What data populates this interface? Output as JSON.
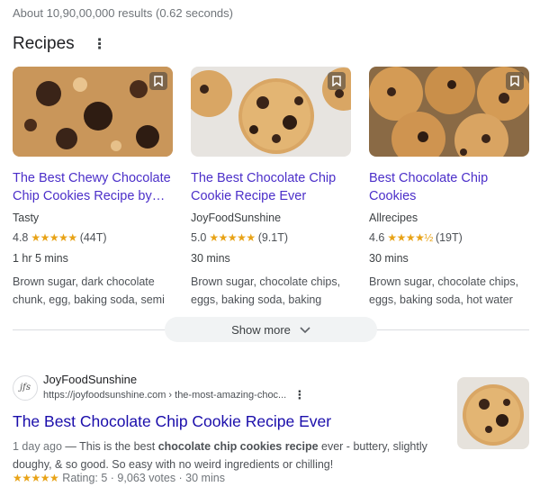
{
  "stats": "About 10,90,00,000 results (0.62 seconds)",
  "recipes": {
    "heading": "Recipes",
    "more_icon": "vertical-dots-icon",
    "cards": [
      {
        "title_line1": "The Best Chewy Chocolate",
        "title_line2": "Chip Cookies Recipe by…",
        "source": "Tasty",
        "rating": "4.8",
        "stars": "★★★★★",
        "votes": "(44T)",
        "time": "1 hr 5 mins",
        "ingredients_line1": "Brown sugar, dark chocolate",
        "ingredients_line2": "chunk, egg, baking soda, semi"
      },
      {
        "title_line1": "The Best Chocolate Chip",
        "title_line2": "Cookie Recipe Ever",
        "source": "JoyFoodSunshine",
        "rating": "5.0",
        "stars": "★★★★★",
        "votes": "(9.1T)",
        "time": "30 mins",
        "ingredients_line1": "Brown sugar, chocolate chips,",
        "ingredients_line2": "eggs, baking soda, baking"
      },
      {
        "title_line1": "Best Chocolate Chip",
        "title_line2": "Cookies",
        "source": "Allrecipes",
        "rating": "4.6",
        "stars": "★★★★½",
        "votes": "(19T)",
        "time": "30 mins",
        "ingredients_line1": "Brown sugar, chocolate chips,",
        "ingredients_line2": "eggs, baking soda, hot water"
      }
    ],
    "show_more": "Show more"
  },
  "result": {
    "site_name": "JoyFoodSunshine",
    "url": "https://joyfoodsunshine.com › the-most-amazing-choc...",
    "favicon_text": "jfs",
    "title": "The Best Chocolate Chip Cookie Recipe Ever",
    "date": "1 day ago",
    "snippet_a": " — This is the best ",
    "snippet_bold": "chocolate chip cookies recipe",
    "snippet_b": " ever - buttery, slightly doughy, & so good. So easy with no weird ingredients or chilling!",
    "stars": "★★★★★",
    "rating_text": "Rating: 5 · 9,063 votes · 30 mins"
  },
  "colors": {
    "link": "#1a0dab",
    "card_title": "#4b2fc9",
    "star": "#e8a317"
  }
}
